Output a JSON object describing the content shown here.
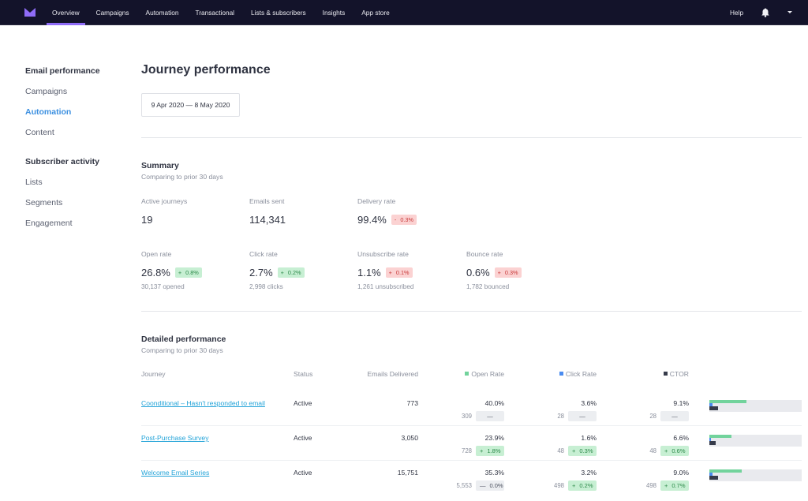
{
  "nav": {
    "logo": "brand-logo",
    "items": [
      {
        "label": "Overview",
        "active": true
      },
      {
        "label": "Campaigns",
        "active": false
      },
      {
        "label": "Automation",
        "active": false
      },
      {
        "label": "Transactional",
        "active": false
      },
      {
        "label": "Lists & subscribers",
        "active": false
      },
      {
        "label": "Insights",
        "active": false
      },
      {
        "label": "App store",
        "active": false
      }
    ],
    "help": "Help",
    "bell_icon": "bell-icon",
    "account_menu_icon": "caret-down-icon",
    "accent": "#8f6cf7",
    "background": "#13132a"
  },
  "sidebar": {
    "groups": [
      {
        "heading": "Email performance",
        "items": [
          {
            "label": "Campaigns",
            "active": false
          },
          {
            "label": "Automation",
            "active": true
          },
          {
            "label": "Content",
            "active": false
          }
        ]
      },
      {
        "heading": "Subscriber activity",
        "items": [
          {
            "label": "Lists",
            "active": false
          },
          {
            "label": "Segments",
            "active": false
          },
          {
            "label": "Engagement",
            "active": false
          }
        ]
      }
    ],
    "active_color": "#3b8fe0"
  },
  "main": {
    "title": "Journey performance",
    "date_range": "9 Apr 2020 — 8 May 2020",
    "summary": {
      "title": "Summary",
      "subtitle": "Comparing to prior 30 days",
      "metrics": [
        {
          "label": "Active journeys",
          "value": "19"
        },
        {
          "label": "Emails sent",
          "value": "114,341"
        },
        {
          "label": "Delivery rate",
          "value": "99.4%",
          "change_sign": "-",
          "change": "0.3%",
          "change_tone": "neg"
        },
        {
          "label": "Open rate",
          "value": "26.8%",
          "change_sign": "+",
          "change": "0.8%",
          "change_tone": "pos",
          "sub": "30,137 opened"
        },
        {
          "label": "Click rate",
          "value": "2.7%",
          "change_sign": "+",
          "change": "0.2%",
          "change_tone": "pos",
          "sub": "2,998 clicks"
        },
        {
          "label": "Unsubscribe rate",
          "value": "1.1%",
          "change_sign": "+",
          "change": "0.1%",
          "change_tone": "neg",
          "sub": "1,261 unsubscribed"
        },
        {
          "label": "Bounce rate",
          "value": "0.6%",
          "change_sign": "+",
          "change": "0.3%",
          "change_tone": "neg",
          "sub": "1,782 bounced"
        }
      ]
    },
    "detailed": {
      "title": "Detailed performance",
      "subtitle": "Comparing to prior 30 days",
      "columns": {
        "journey": "Journey",
        "status": "Status",
        "delivered": "Emails Delivered",
        "open_rate": "Open Rate",
        "click_rate": "Click Rate",
        "ctor": "CTOR"
      },
      "legend_colors": {
        "open_rate": "#72d39c",
        "click_rate": "#4a8cf0",
        "ctor": "#373c4b"
      },
      "rows": [
        {
          "journey": "Coonditional – Hasn't responded to email",
          "status": "Active",
          "delivered": "773",
          "open_rate": {
            "value": "40.0%",
            "count": "309",
            "sign": "",
            "change": "—",
            "tone": "neutral",
            "fraction": 0.4
          },
          "click_rate": {
            "value": "3.6%",
            "count": "28",
            "sign": "",
            "change": "—",
            "tone": "neutral",
            "fraction": 0.036
          },
          "ctor": {
            "value": "9.1%",
            "count": "28",
            "sign": "",
            "change": "—",
            "tone": "neutral",
            "fraction": 0.091
          }
        },
        {
          "journey": "Post-Purchase Survey",
          "status": "Active",
          "delivered": "3,050",
          "open_rate": {
            "value": "23.9%",
            "count": "728",
            "sign": "+",
            "change": "1.8%",
            "tone": "pos",
            "fraction": 0.239
          },
          "click_rate": {
            "value": "1.6%",
            "count": "48",
            "sign": "+",
            "change": "0.3%",
            "tone": "pos",
            "fraction": 0.016
          },
          "ctor": {
            "value": "6.6%",
            "count": "48",
            "sign": "+",
            "change": "0.6%",
            "tone": "pos",
            "fraction": 0.066
          }
        },
        {
          "journey": "Welcome Email Series",
          "status": "Active",
          "delivered": "15,751",
          "open_rate": {
            "value": "35.3%",
            "count": "5,553",
            "sign": "—",
            "change": "0.0%",
            "tone": "neutral",
            "fraction": 0.353
          },
          "click_rate": {
            "value": "3.2%",
            "count": "498",
            "sign": "+",
            "change": "0.2%",
            "tone": "pos",
            "fraction": 0.032
          },
          "ctor": {
            "value": "9.0%",
            "count": "498",
            "sign": "+",
            "change": "0.7%",
            "tone": "pos",
            "fraction": 0.09
          }
        }
      ]
    }
  }
}
